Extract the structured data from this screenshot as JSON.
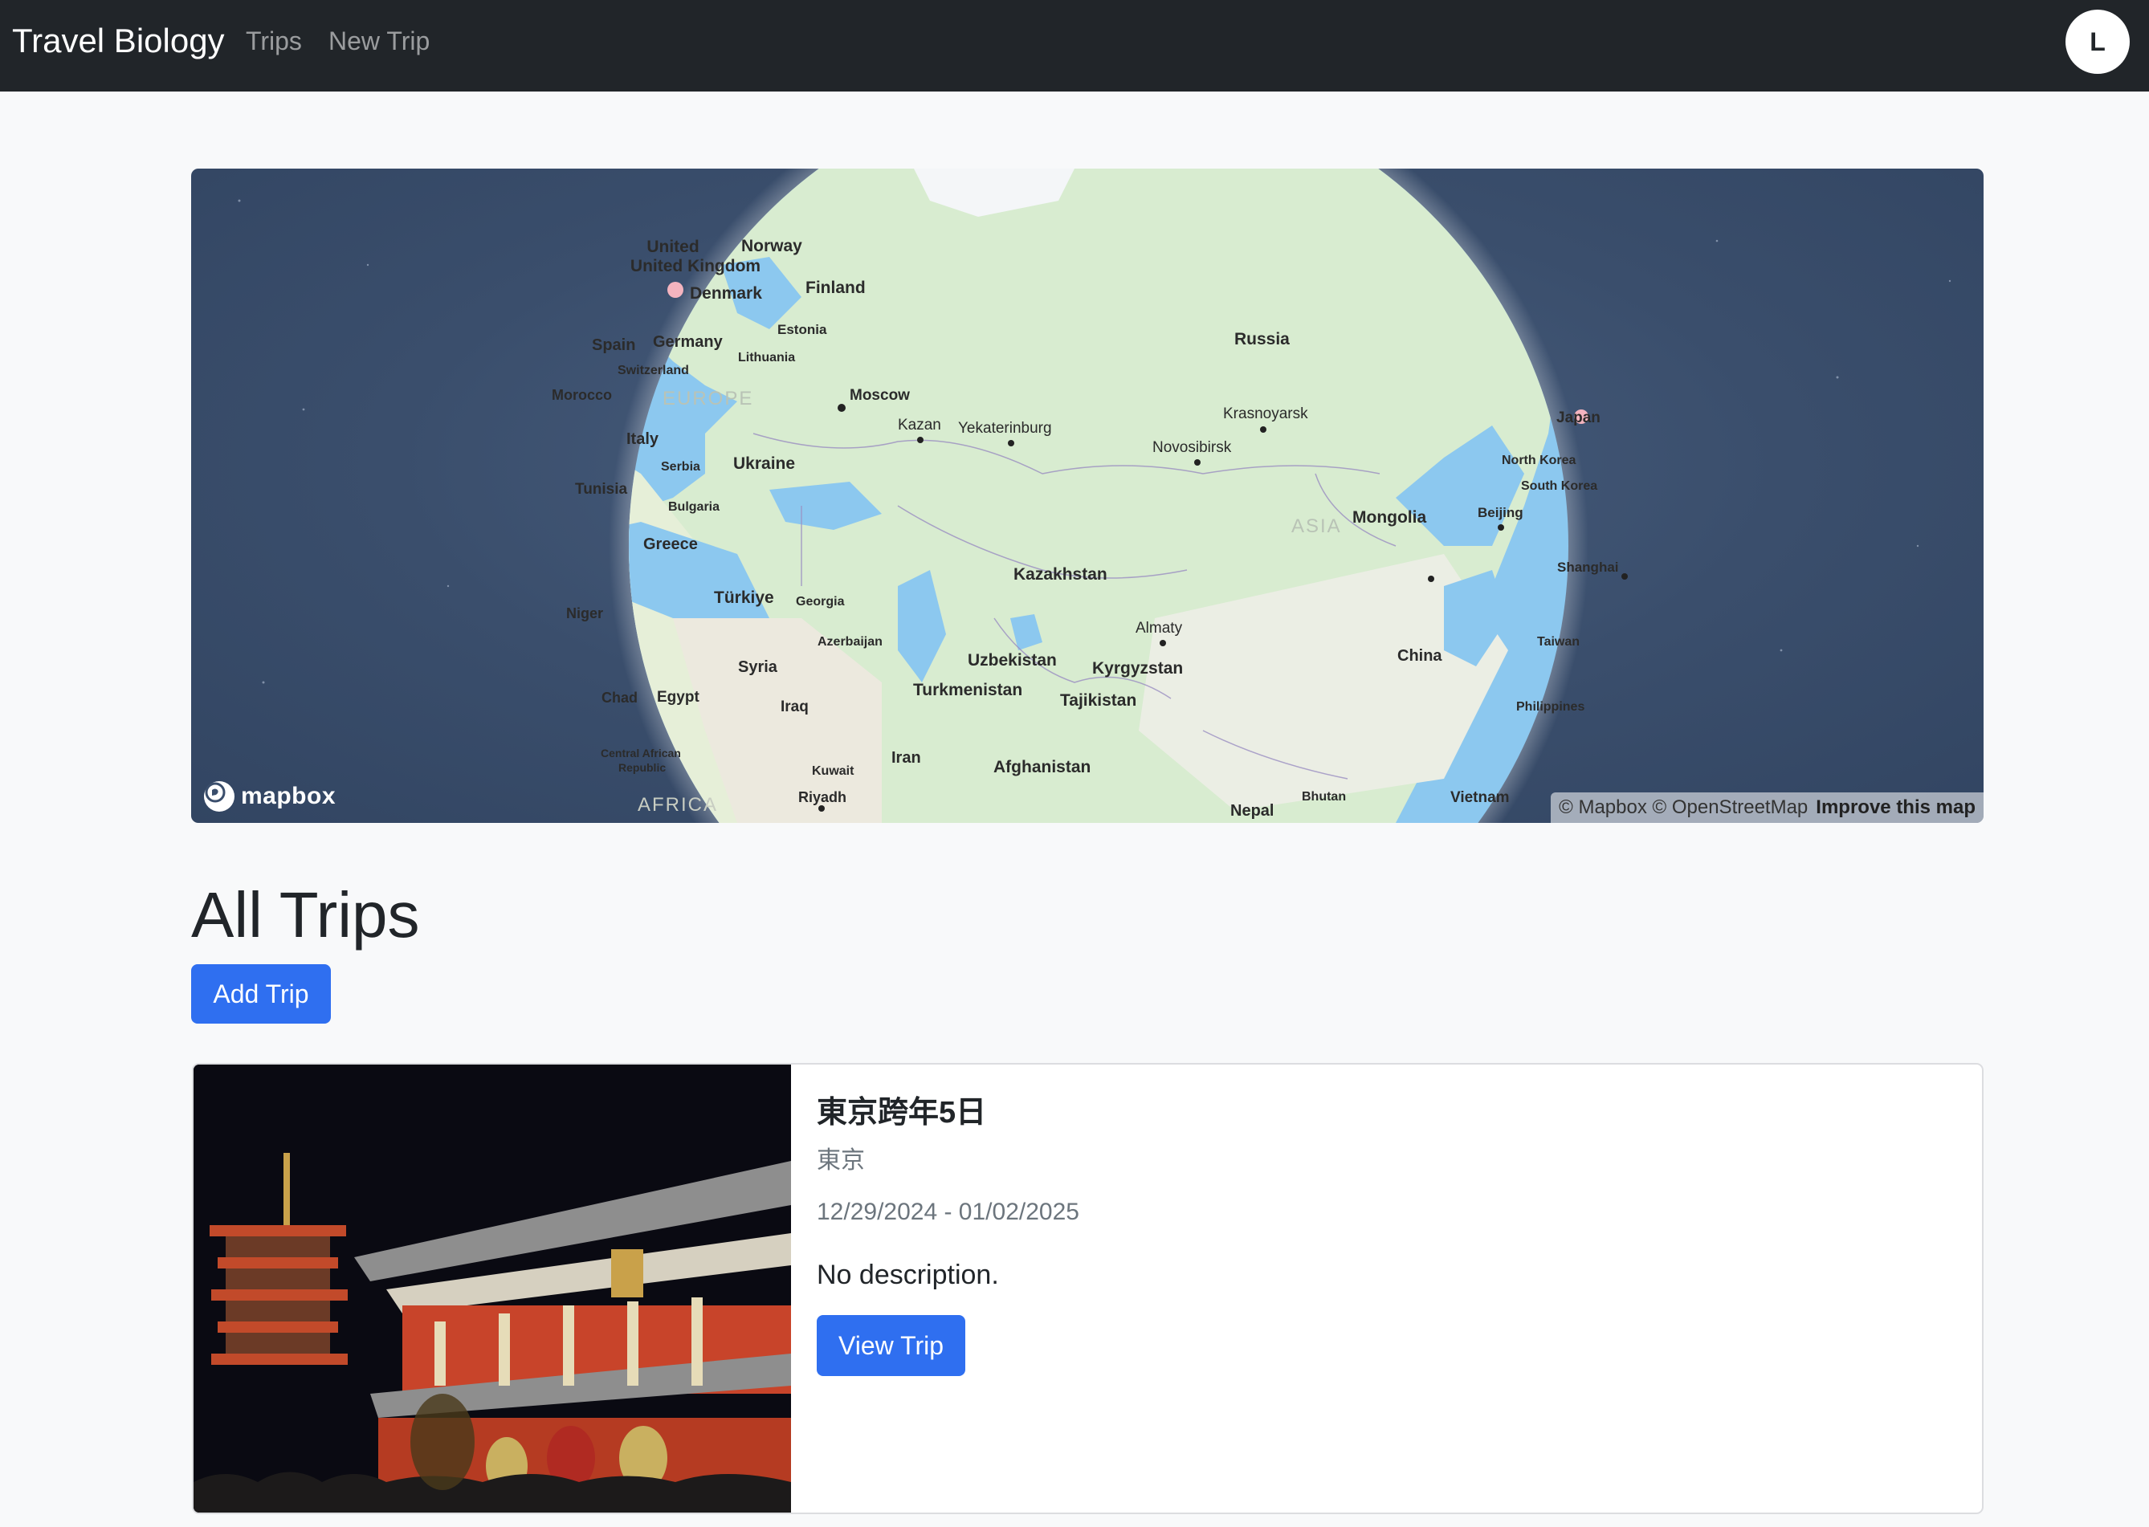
{
  "navbar": {
    "brand": "Travel Biology",
    "links": [
      "Trips",
      "New Trip"
    ],
    "avatar_initial": "L"
  },
  "map": {
    "logo_text": "mapbox",
    "attribution": "© Mapbox © OpenStreetMap",
    "improve_link": "Improve this map",
    "labels": {
      "united_kingdom": "United Kingdom",
      "norway": "Norway",
      "denmark": "Denmark",
      "finland": "Finland",
      "estonia": "Estonia",
      "spain": "Spain",
      "germany": "Germany",
      "lithuania": "Lithuania",
      "switzerland": "Switzerland",
      "morocco": "Morocco",
      "europe": "EUROPE",
      "moscow": "Moscow",
      "kazan": "Kazan",
      "yekaterinburg": "Yekaterinburg",
      "russia": "Russia",
      "krasnoyarsk": "Krasnoyarsk",
      "novosibirsk": "Novosibirsk",
      "japan": "Japan",
      "north_korea": "North Korea",
      "south_korea": "South Korea",
      "italy": "Italy",
      "serbia": "Serbia",
      "ukraine": "Ukraine",
      "tunisia": "Tunisia",
      "bulgaria": "Bulgaria",
      "greece": "Greece",
      "asia": "ASIA",
      "mongolia": "Mongolia",
      "beijing": "Beijing",
      "shanghai": "Shanghai",
      "kazakhstan": "Kazakhstan",
      "turkiye": "Türkiye",
      "georgia": "Georgia",
      "niger": "Niger",
      "azerbaijan": "Azerbaijan",
      "almaty": "Almaty",
      "uzbekistan": "Uzbekistan",
      "kyrgyzstan": "Kyrgyzstan",
      "china": "China",
      "taiwan": "Taiwan",
      "syria": "Syria",
      "turkmenistan": "Turkmenistan",
      "chad": "Chad",
      "egypt": "Egypt",
      "iraq": "Iraq",
      "tajikistan": "Tajikistan",
      "philippines": "Philippines",
      "central_african_republic": "Central African Republic",
      "iran": "Iran",
      "afghanistan": "Afghanistan",
      "kuwait": "Kuwait",
      "riyadh": "Riyadh",
      "africa": "AFRICA",
      "nepal": "Nepal",
      "bhutan": "Bhutan",
      "vietnam": "Vietnam"
    },
    "trip_markers": [
      "United Kingdom",
      "Japan"
    ],
    "colors": {
      "ocean": "#8cc8ef",
      "land": "#d8ecd0",
      "marker": "#f4b4bf",
      "space": "#3a4e6c"
    }
  },
  "page": {
    "title": "All Trips",
    "add_button": "Add Trip"
  },
  "trips": [
    {
      "name": "東京跨年5日",
      "place": "東京",
      "dates": "12/29/2024 - 01/02/2025",
      "description": "No description.",
      "view_button": "View Trip"
    }
  ],
  "colors": {
    "navbar": "#212529",
    "primary": "#2f6ff0",
    "background": "#f8f9fa"
  }
}
